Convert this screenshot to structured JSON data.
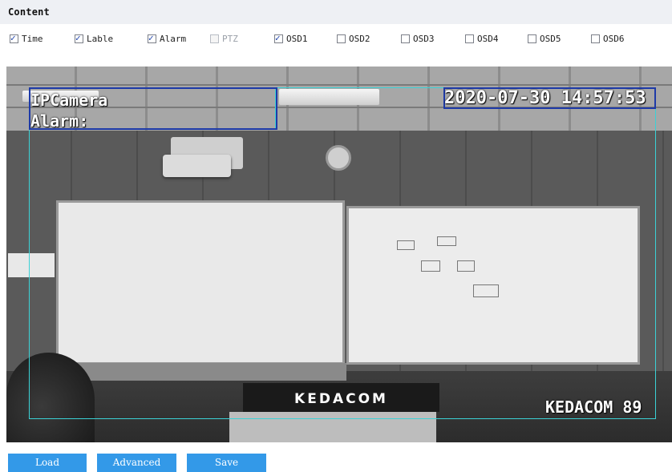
{
  "header": {
    "title": "Content"
  },
  "options": [
    {
      "label": "Time",
      "checked": true,
      "disabled": false
    },
    {
      "label": "Lable",
      "checked": true,
      "disabled": false
    },
    {
      "label": "Alarm",
      "checked": true,
      "disabled": false
    },
    {
      "label": "PTZ",
      "checked": false,
      "disabled": true
    },
    {
      "label": "OSD1",
      "checked": true,
      "disabled": false
    },
    {
      "label": "OSD2",
      "checked": false,
      "disabled": false
    },
    {
      "label": "OSD3",
      "checked": false,
      "disabled": false
    },
    {
      "label": "OSD4",
      "checked": false,
      "disabled": false
    },
    {
      "label": "OSD5",
      "checked": false,
      "disabled": false
    },
    {
      "label": "OSD6",
      "checked": false,
      "disabled": false
    }
  ],
  "video": {
    "label_osd": "IPCamera",
    "alarm_osd": "Alarm:",
    "time_osd": "2020-07-30 14:57:53",
    "osd1": "KEDACOM 89",
    "podium_brand": "KEDACOM"
  },
  "buttons": {
    "load": "Load",
    "advanced": "Advanced",
    "save": "Save"
  },
  "colors": {
    "accent": "#3399e8",
    "osd_frame": "#3bd2d6",
    "osd_selected": "#1e3aa8"
  }
}
